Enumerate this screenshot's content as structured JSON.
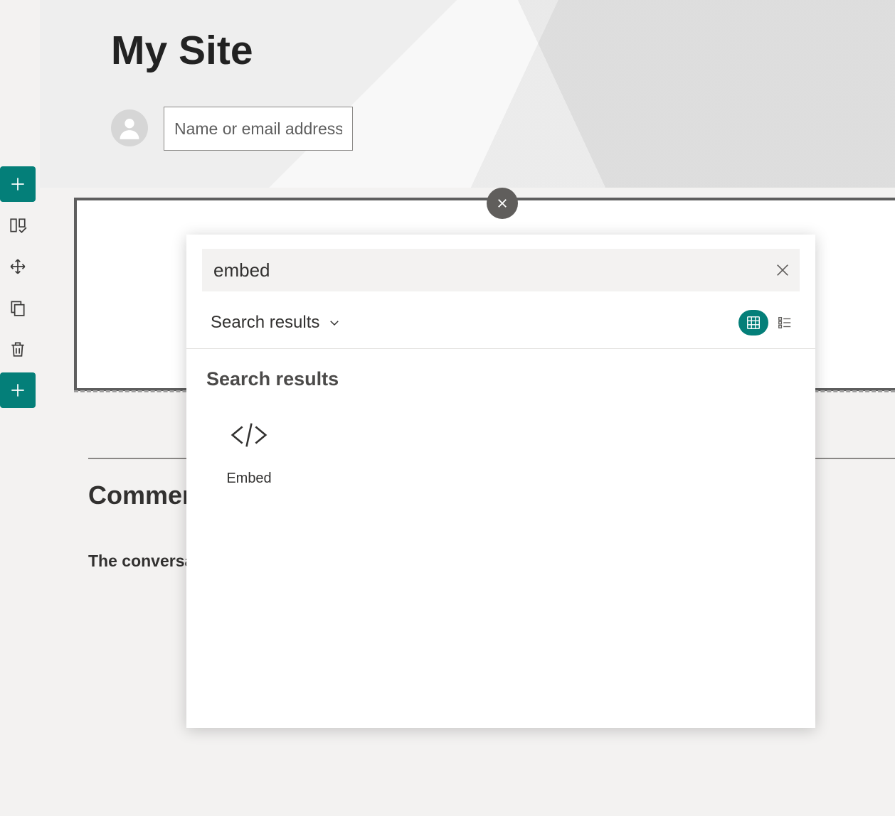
{
  "header": {
    "site_title": "My Site",
    "name_placeholder": "Name or email address"
  },
  "picker": {
    "search_value": "embed",
    "filter_label": "Search results",
    "results_heading": "Search results",
    "results": [
      {
        "label": "Embed"
      }
    ]
  },
  "page": {
    "comments_heading": "Comments",
    "conversation_text": "The conversation"
  }
}
